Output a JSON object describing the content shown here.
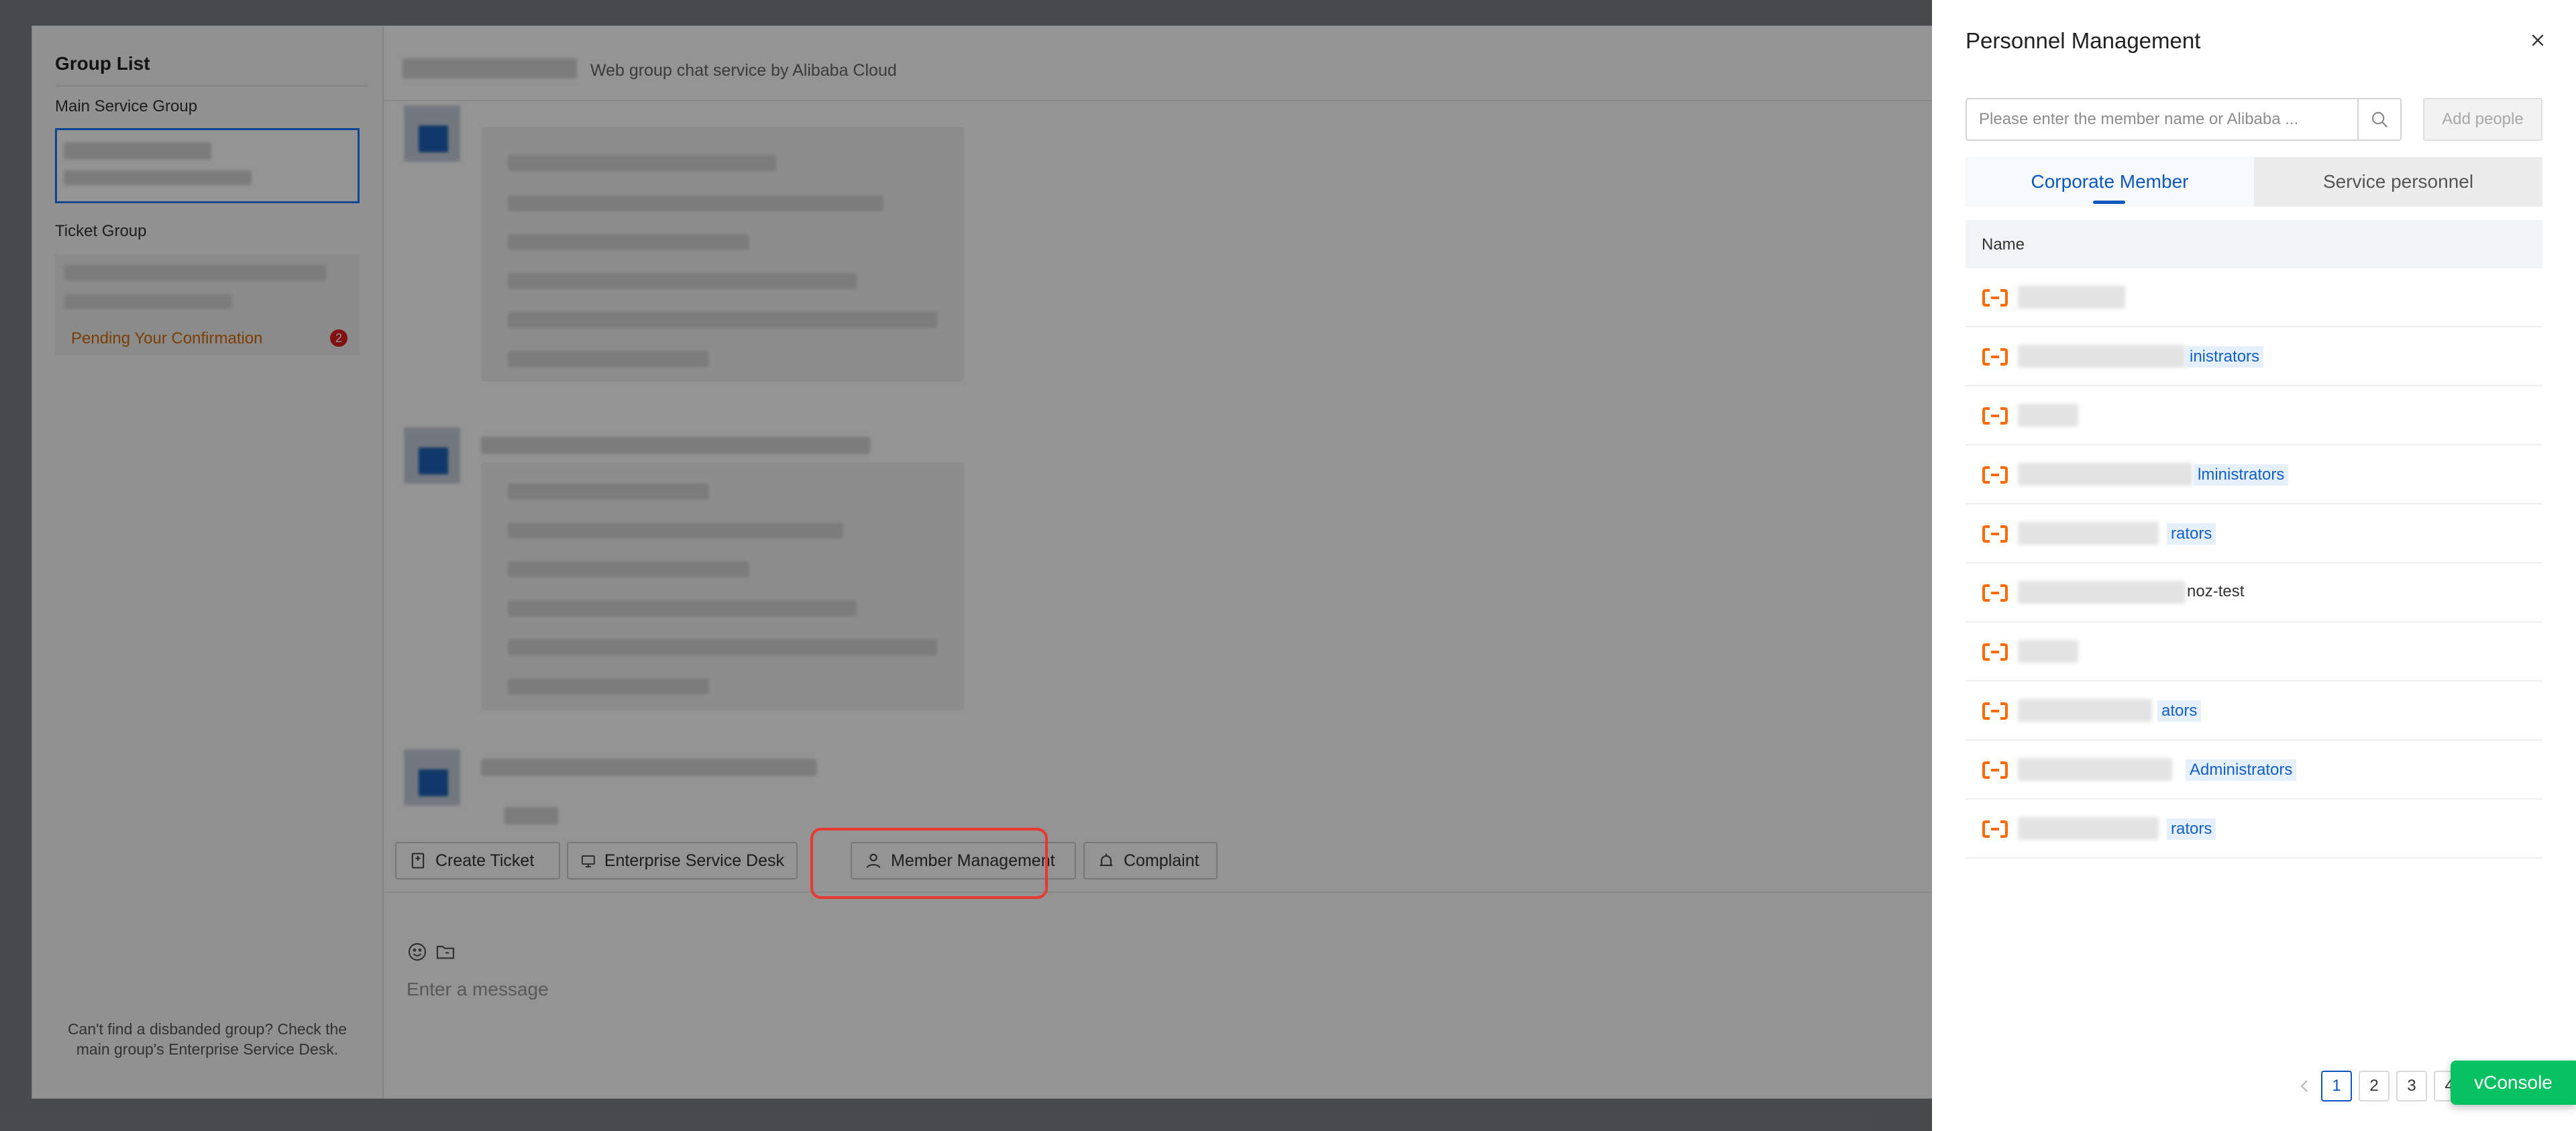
{
  "group_list": {
    "title": "Group List",
    "main_service_group_label": "Main Service Group",
    "ticket_group_label": "Ticket Group",
    "pending_text": "Pending Your Confirmation",
    "pending_count": "2",
    "footer_note": "Can't find a disbanded group? Check the main group's Enterprise Service Desk."
  },
  "chat": {
    "subtitle": "Web group chat service by Alibaba Cloud",
    "toolbar": {
      "create_ticket": "Create Ticket",
      "enterprise_service_desk": "Enterprise Service Desk",
      "member_management": "Member Management",
      "complaint": "Complaint"
    },
    "input_placeholder": "Enter a message"
  },
  "drawer": {
    "title": "Personnel Management",
    "search_placeholder": "Please enter the member name or Alibaba ...",
    "add_people": "Add people",
    "tabs": [
      {
        "label": "Corporate Member",
        "active": true
      },
      {
        "label": "Service personnel",
        "active": false
      }
    ],
    "column_name": "Name",
    "rows": [
      {
        "visible_text": "",
        "style": "none"
      },
      {
        "visible_text": "inistrators",
        "style": "tag"
      },
      {
        "visible_text": "",
        "style": "none"
      },
      {
        "visible_text": "lministrators",
        "style": "tag"
      },
      {
        "visible_text": "rators",
        "style": "tag"
      },
      {
        "visible_text": "noz-test",
        "style": "plain"
      },
      {
        "visible_text": "",
        "style": "none"
      },
      {
        "visible_text": "ators",
        "style": "tag"
      },
      {
        "visible_text": "Administrators",
        "style": "tag"
      },
      {
        "visible_text": "rators",
        "style": "tag"
      }
    ],
    "pagination": {
      "pages": [
        "1",
        "2",
        "3",
        "4"
      ],
      "current": "1"
    }
  },
  "vconsole_label": "vConsole",
  "colors": {
    "accent_blue": "#0a57c2",
    "alibaba_orange": "#ff6a00",
    "highlight_red": "#e8382f",
    "vconsole_green": "#07c160"
  },
  "icons": {
    "close": "close-icon",
    "search": "search-icon",
    "member_row": "alibaba-cloud-logo-icon"
  }
}
